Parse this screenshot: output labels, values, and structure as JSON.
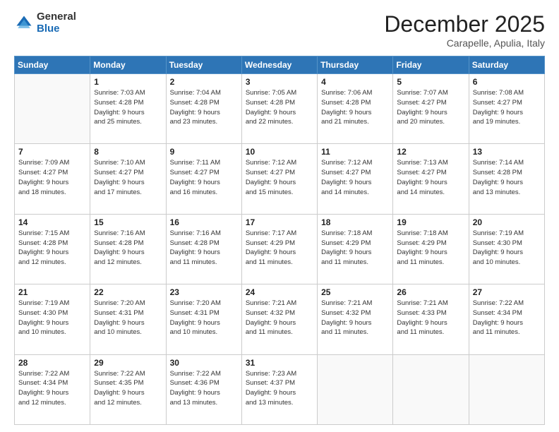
{
  "logo": {
    "general": "General",
    "blue": "Blue"
  },
  "header": {
    "month": "December 2025",
    "location": "Carapelle, Apulia, Italy"
  },
  "weekdays": [
    "Sunday",
    "Monday",
    "Tuesday",
    "Wednesday",
    "Thursday",
    "Friday",
    "Saturday"
  ],
  "weeks": [
    [
      {
        "day": "",
        "info": ""
      },
      {
        "day": "1",
        "info": "Sunrise: 7:03 AM\nSunset: 4:28 PM\nDaylight: 9 hours\nand 25 minutes."
      },
      {
        "day": "2",
        "info": "Sunrise: 7:04 AM\nSunset: 4:28 PM\nDaylight: 9 hours\nand 23 minutes."
      },
      {
        "day": "3",
        "info": "Sunrise: 7:05 AM\nSunset: 4:28 PM\nDaylight: 9 hours\nand 22 minutes."
      },
      {
        "day": "4",
        "info": "Sunrise: 7:06 AM\nSunset: 4:28 PM\nDaylight: 9 hours\nand 21 minutes."
      },
      {
        "day": "5",
        "info": "Sunrise: 7:07 AM\nSunset: 4:27 PM\nDaylight: 9 hours\nand 20 minutes."
      },
      {
        "day": "6",
        "info": "Sunrise: 7:08 AM\nSunset: 4:27 PM\nDaylight: 9 hours\nand 19 minutes."
      }
    ],
    [
      {
        "day": "7",
        "info": "Sunrise: 7:09 AM\nSunset: 4:27 PM\nDaylight: 9 hours\nand 18 minutes."
      },
      {
        "day": "8",
        "info": "Sunrise: 7:10 AM\nSunset: 4:27 PM\nDaylight: 9 hours\nand 17 minutes."
      },
      {
        "day": "9",
        "info": "Sunrise: 7:11 AM\nSunset: 4:27 PM\nDaylight: 9 hours\nand 16 minutes."
      },
      {
        "day": "10",
        "info": "Sunrise: 7:12 AM\nSunset: 4:27 PM\nDaylight: 9 hours\nand 15 minutes."
      },
      {
        "day": "11",
        "info": "Sunrise: 7:12 AM\nSunset: 4:27 PM\nDaylight: 9 hours\nand 14 minutes."
      },
      {
        "day": "12",
        "info": "Sunrise: 7:13 AM\nSunset: 4:27 PM\nDaylight: 9 hours\nand 14 minutes."
      },
      {
        "day": "13",
        "info": "Sunrise: 7:14 AM\nSunset: 4:28 PM\nDaylight: 9 hours\nand 13 minutes."
      }
    ],
    [
      {
        "day": "14",
        "info": "Sunrise: 7:15 AM\nSunset: 4:28 PM\nDaylight: 9 hours\nand 12 minutes."
      },
      {
        "day": "15",
        "info": "Sunrise: 7:16 AM\nSunset: 4:28 PM\nDaylight: 9 hours\nand 12 minutes."
      },
      {
        "day": "16",
        "info": "Sunrise: 7:16 AM\nSunset: 4:28 PM\nDaylight: 9 hours\nand 11 minutes."
      },
      {
        "day": "17",
        "info": "Sunrise: 7:17 AM\nSunset: 4:29 PM\nDaylight: 9 hours\nand 11 minutes."
      },
      {
        "day": "18",
        "info": "Sunrise: 7:18 AM\nSunset: 4:29 PM\nDaylight: 9 hours\nand 11 minutes."
      },
      {
        "day": "19",
        "info": "Sunrise: 7:18 AM\nSunset: 4:29 PM\nDaylight: 9 hours\nand 11 minutes."
      },
      {
        "day": "20",
        "info": "Sunrise: 7:19 AM\nSunset: 4:30 PM\nDaylight: 9 hours\nand 10 minutes."
      }
    ],
    [
      {
        "day": "21",
        "info": "Sunrise: 7:19 AM\nSunset: 4:30 PM\nDaylight: 9 hours\nand 10 minutes."
      },
      {
        "day": "22",
        "info": "Sunrise: 7:20 AM\nSunset: 4:31 PM\nDaylight: 9 hours\nand 10 minutes."
      },
      {
        "day": "23",
        "info": "Sunrise: 7:20 AM\nSunset: 4:31 PM\nDaylight: 9 hours\nand 10 minutes."
      },
      {
        "day": "24",
        "info": "Sunrise: 7:21 AM\nSunset: 4:32 PM\nDaylight: 9 hours\nand 11 minutes."
      },
      {
        "day": "25",
        "info": "Sunrise: 7:21 AM\nSunset: 4:32 PM\nDaylight: 9 hours\nand 11 minutes."
      },
      {
        "day": "26",
        "info": "Sunrise: 7:21 AM\nSunset: 4:33 PM\nDaylight: 9 hours\nand 11 minutes."
      },
      {
        "day": "27",
        "info": "Sunrise: 7:22 AM\nSunset: 4:34 PM\nDaylight: 9 hours\nand 11 minutes."
      }
    ],
    [
      {
        "day": "28",
        "info": "Sunrise: 7:22 AM\nSunset: 4:34 PM\nDaylight: 9 hours\nand 12 minutes."
      },
      {
        "day": "29",
        "info": "Sunrise: 7:22 AM\nSunset: 4:35 PM\nDaylight: 9 hours\nand 12 minutes."
      },
      {
        "day": "30",
        "info": "Sunrise: 7:22 AM\nSunset: 4:36 PM\nDaylight: 9 hours\nand 13 minutes."
      },
      {
        "day": "31",
        "info": "Sunrise: 7:23 AM\nSunset: 4:37 PM\nDaylight: 9 hours\nand 13 minutes."
      },
      {
        "day": "",
        "info": ""
      },
      {
        "day": "",
        "info": ""
      },
      {
        "day": "",
        "info": ""
      }
    ]
  ]
}
